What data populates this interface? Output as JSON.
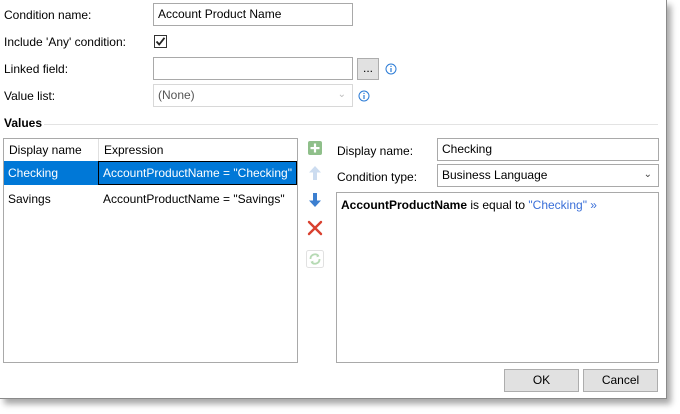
{
  "form": {
    "condition_name_label": "Condition name:",
    "condition_name_value": "Account Product Name",
    "include_any_label": "Include 'Any' condition:",
    "include_any_checked": true,
    "linked_field_label": "Linked field:",
    "linked_field_value": "",
    "browse_button": "...",
    "value_list_label": "Value list:",
    "value_list_value": "(None)"
  },
  "values_section": {
    "title": "Values",
    "columns": [
      "Display name",
      "Expression"
    ],
    "rows": [
      {
        "display_name": "Checking",
        "expression": "AccountProductName = \"Checking\"",
        "selected": true
      },
      {
        "display_name": "Savings",
        "expression": "AccountProductName = \"Savings\"",
        "selected": false
      }
    ]
  },
  "toolbar": {
    "add_icon": "plus-icon",
    "move_up_icon": "arrow-up-icon",
    "move_down_icon": "arrow-down-icon",
    "delete_icon": "delete-x-icon",
    "refresh_icon": "refresh-icon"
  },
  "detail": {
    "display_name_label": "Display name:",
    "display_name_value": "Checking",
    "condition_type_label": "Condition type:",
    "condition_type_value": "Business Language",
    "preview_field": "AccountProductName",
    "preview_operator": " is equal to ",
    "preview_value": "\"Checking\" »"
  },
  "buttons": {
    "ok": "OK",
    "cancel": "Cancel"
  },
  "colors": {
    "selection": "#0078d7",
    "link_value": "#3a6fd8",
    "info_icon": "#2b7bd6"
  }
}
